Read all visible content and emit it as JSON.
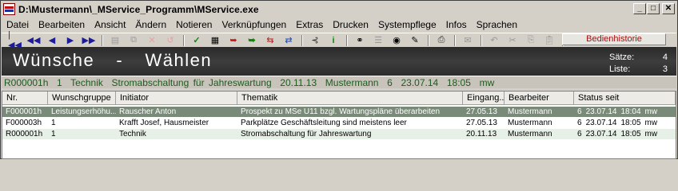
{
  "window": {
    "title": "D:\\Mustermann\\_MService_Programm\\MService.exe"
  },
  "window_buttons": {
    "minimize": "_",
    "maximize": "□",
    "close": "✕"
  },
  "menu": [
    "Datei",
    "Bearbeiten",
    "Ansicht",
    "Ändern",
    "Notieren",
    "Verknüpfungen",
    "Extras",
    "Drucken",
    "Systempflege",
    "Infos",
    "Sprachen"
  ],
  "toolbar": {
    "history_button": "Bedienhistorie"
  },
  "header": {
    "title": "Wünsche  -  Wählen",
    "saetze_label": "Sätze:",
    "saetze_value": "4",
    "liste_label": "Liste:",
    "liste_value": "3"
  },
  "selected_info": "R000001h  1  Technik  Stromabschaltung für Jahreswartung  20.11.13  Mustermann  6  23.07.14  18:05  mw",
  "table": {
    "columns": [
      "Nr.",
      "Wunschgruppe",
      "Initiator",
      "Thematik",
      "Eingang...",
      "Bearbeiter",
      "Status seit"
    ],
    "rows": [
      {
        "nr": "F000001h",
        "gruppe": "Leistungserhöhu...",
        "initiator": "Rauscher Anton",
        "thematik": "Prospekt zu MSe U11 bzgl. Wartungspläne überarbeiten",
        "eingang": "27.05.13",
        "bearbeiter": "Mustermann",
        "status": "6",
        "datum": "23.07.14",
        "zeit": "18:04",
        "kuerzel": "mw"
      },
      {
        "nr": "F000003h",
        "gruppe": "1",
        "initiator": "Krafft Josef, Hausmeister",
        "thematik": "Parkplätze Geschäftsleitung sind meistens leer",
        "eingang": "27.05.13",
        "bearbeiter": "Mustermann",
        "status": "6",
        "datum": "23.07.14",
        "zeit": "18:05",
        "kuerzel": "mw"
      },
      {
        "nr": "R000001h",
        "gruppe": "1",
        "initiator": "Technik",
        "thematik": "Stromabschaltung für Jahreswartung",
        "eingang": "20.11.13",
        "bearbeiter": "Mustermann",
        "status": "6",
        "datum": "23.07.14",
        "zeit": "18:05",
        "kuerzel": "mw"
      }
    ]
  }
}
